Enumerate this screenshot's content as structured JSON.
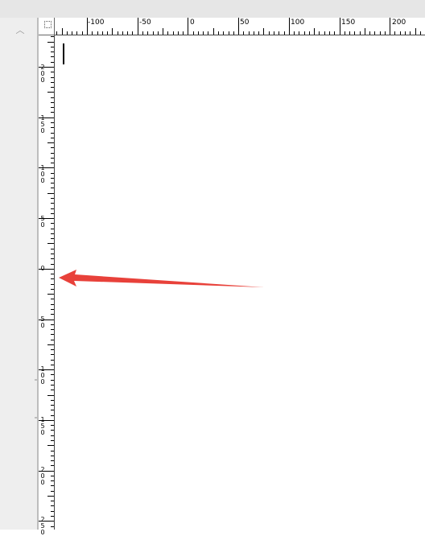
{
  "horizontal_ruler": {
    "labels": [
      "-100",
      "-50",
      "0",
      "50",
      "100",
      "150",
      "200"
    ]
  },
  "vertical_ruler": {
    "labels": [
      "200",
      "150",
      "100",
      "50",
      "0",
      "50",
      "100",
      "150",
      "200",
      "250"
    ]
  },
  "scroll_up_glyph": "︿",
  "annotation_arrow": {
    "color": "#e8413a",
    "points_to": "vertical ruler zero mark"
  }
}
